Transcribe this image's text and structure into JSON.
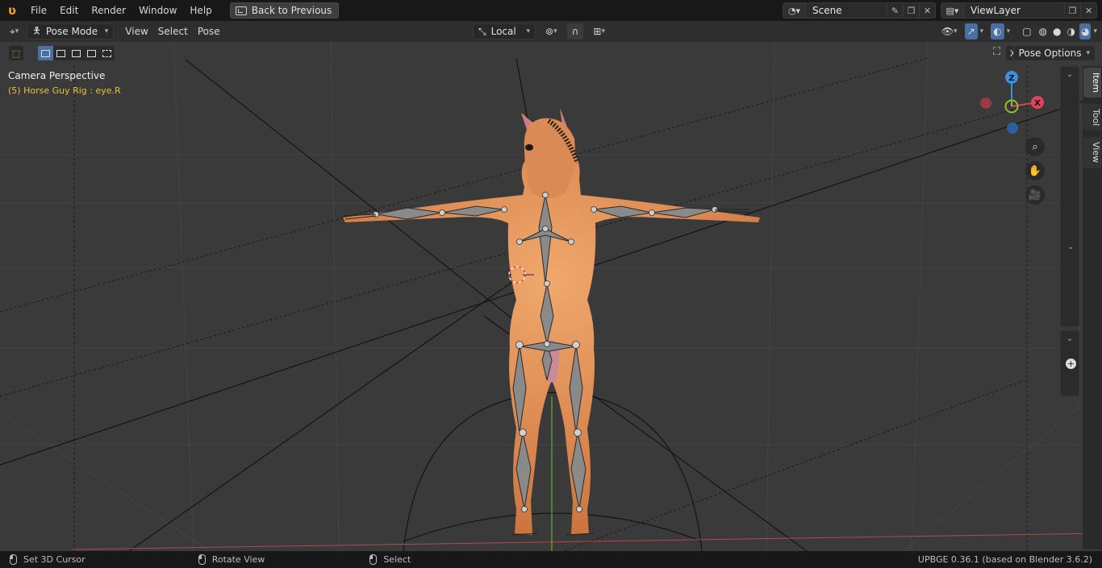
{
  "menubar": {
    "items": [
      "File",
      "Edit",
      "Render",
      "Window",
      "Help"
    ],
    "back_button": "Back to Previous",
    "scene": "Scene",
    "view_layer": "ViewLayer"
  },
  "header": {
    "mode": "Pose Mode",
    "menus": [
      "View",
      "Select",
      "Pose"
    ],
    "transform_orientation": "Local"
  },
  "viewport": {
    "camera_label": "Camera Perspective",
    "active_object": "(5) Horse Guy Rig : eye.R",
    "pose_options": "Pose Options",
    "gizmo": {
      "z": "Z",
      "x": "X"
    }
  },
  "sidebar": {
    "tabs": [
      "Item",
      "Tool",
      "View"
    ]
  },
  "statusbar": {
    "left": "Set 3D Cursor",
    "middle": "Rotate View",
    "right": "Select",
    "version": "UPBGE 0.36.1 (based on Blender 3.6.2)"
  },
  "colors": {
    "accent_blue": "#4a6fa3",
    "axis_x": "#e0435a",
    "axis_y": "#8fbf2a",
    "axis_z": "#3d8fe0",
    "skin": "#e8935a",
    "active_text": "#e8c23a"
  }
}
